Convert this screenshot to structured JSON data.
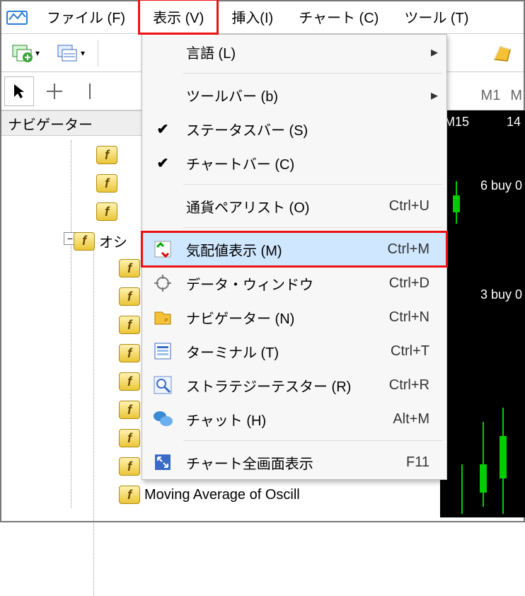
{
  "menubar": {
    "items": [
      {
        "label": "ファイル (F)"
      },
      {
        "label": "表示 (V)",
        "open": true
      },
      {
        "label": "挿入(I)"
      },
      {
        "label": "チャート (C)"
      },
      {
        "label": "ツール (T)"
      }
    ]
  },
  "timeframe": {
    "m1": "M1",
    "m2": "M"
  },
  "nav": {
    "title": "ナビゲーター"
  },
  "tree": {
    "osc_label": "オシ",
    "last_label": "Moving Average of Oscill",
    "expander": "−"
  },
  "chart": {
    "pair_tf": "M15",
    "num14": "14",
    "trade1": "6 buy 0",
    "trade2": "3 buy 0"
  },
  "menu": {
    "items": [
      {
        "type": "item",
        "icon": "",
        "label": "言語 (L)",
        "accel": "",
        "submenu": true
      },
      {
        "type": "sep"
      },
      {
        "type": "item",
        "icon": "",
        "label": "ツールバー (b)",
        "accel": "",
        "submenu": true
      },
      {
        "type": "item",
        "icon": "check",
        "label": "ステータスバー (S)",
        "accel": ""
      },
      {
        "type": "item",
        "icon": "check",
        "label": "チャートバー (C)",
        "accel": ""
      },
      {
        "type": "sep"
      },
      {
        "type": "item",
        "icon": "",
        "label": "通貨ペアリスト (O)",
        "accel": "Ctrl+U"
      },
      {
        "type": "sep"
      },
      {
        "type": "item",
        "icon": "marketwatch",
        "label": "気配値表示 (M)",
        "accel": "Ctrl+M",
        "highlight": true
      },
      {
        "type": "item",
        "icon": "crosshair",
        "label": "データ・ウィンドウ",
        "accel": "Ctrl+D"
      },
      {
        "type": "item",
        "icon": "navigator",
        "label": "ナビゲーター (N)",
        "accel": "Ctrl+N"
      },
      {
        "type": "item",
        "icon": "terminal",
        "label": "ターミナル (T)",
        "accel": "Ctrl+T"
      },
      {
        "type": "item",
        "icon": "tester",
        "label": "ストラテジーテスター (R)",
        "accel": "Ctrl+R"
      },
      {
        "type": "item",
        "icon": "chat",
        "label": "チャット (H)",
        "accel": "Alt+M"
      },
      {
        "type": "sep"
      },
      {
        "type": "item",
        "icon": "fullscreen",
        "label": "チャート全画面表示",
        "accel": "F11"
      }
    ]
  }
}
